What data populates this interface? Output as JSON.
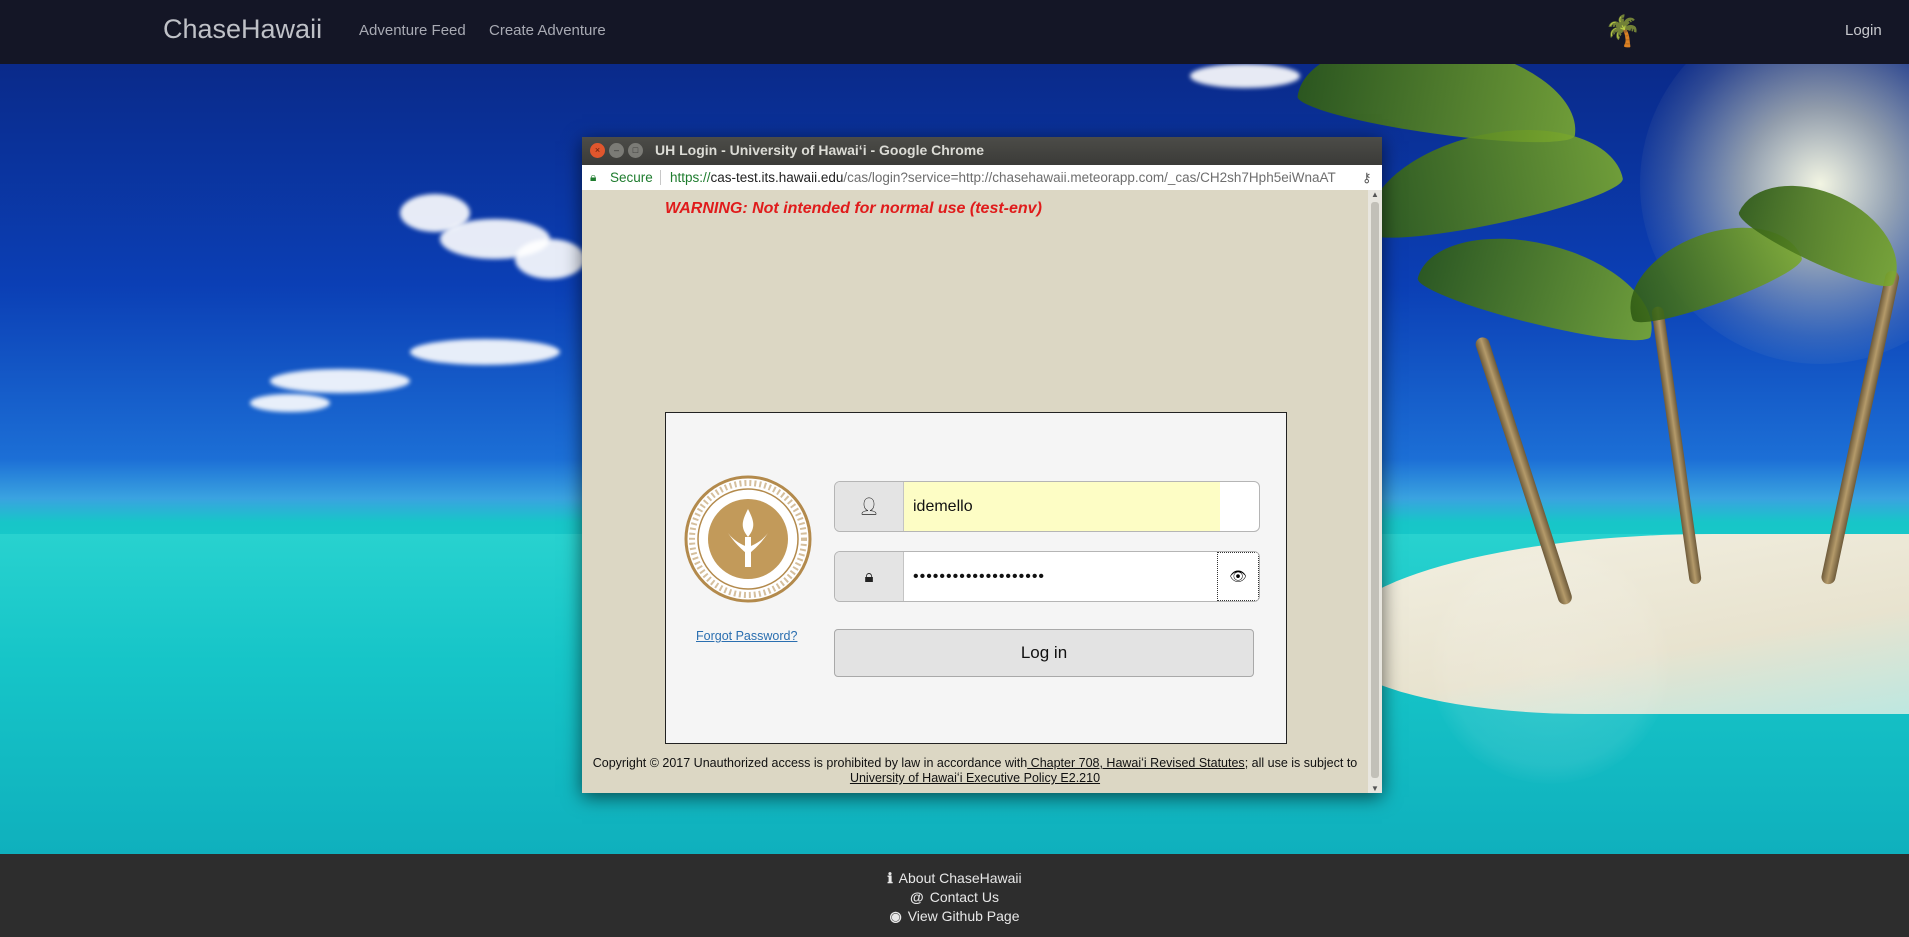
{
  "navbar": {
    "brand": "ChaseHawaii",
    "links": [
      "Adventure Feed",
      "Create Adventure"
    ],
    "palm_icon": "palm-tree-icon",
    "login": "Login"
  },
  "popup": {
    "title": "UH Login - University of Hawaiʻi - Google Chrome",
    "address": {
      "secure_label": "Secure",
      "url_scheme": "https://",
      "url_host": "cas-test.its.hawaii.edu",
      "url_path": "/cas/login?service=http://chasehawaii.meteorapp.com/_cas/CH2sh7Hph5eiWnaAT"
    },
    "warning": "WARNING: Not intended for normal use (test-env)",
    "login": {
      "username_value": "idemello",
      "password_mask": "••••••••••••••••••••",
      "forgot": "Forgot Password?",
      "button": "Log in"
    },
    "footer": {
      "copyright": "Copyright © 2017 Unauthorized access is prohibited by law in accordance with",
      "chapter_link": " Chapter 708, Hawaiʻi Revised Statutes",
      "middle": "; all use is subject to",
      "policy_link": " University of Hawaiʻi Executive Policy E2.210"
    }
  },
  "footer": {
    "about": "About ChaseHawaii",
    "contact": "Contact Us",
    "github": "View Github Page"
  },
  "colors": {
    "warning": "#e01b1b",
    "secure": "#1e7c2e",
    "link": "#2b6fb0",
    "autofill": "#fdfdc5"
  }
}
